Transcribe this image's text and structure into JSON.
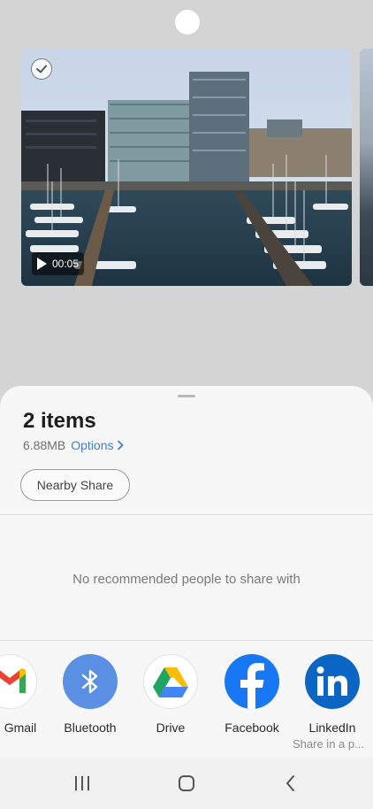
{
  "media": {
    "duration": "00:05",
    "selected": true
  },
  "share_sheet": {
    "title": "2 items",
    "size": "6.88MB",
    "options_label": "Options",
    "nearby_share_label": "Nearby Share",
    "no_people_text": "No recommended people to share with"
  },
  "apps": [
    {
      "label": "Gmail",
      "visible_label": "Gmail",
      "icon": "gmail-icon"
    },
    {
      "label": "Bluetooth",
      "icon": "bluetooth-icon"
    },
    {
      "label": "Drive",
      "icon": "drive-icon"
    },
    {
      "label": "Facebook",
      "icon": "facebook-icon"
    },
    {
      "label": "LinkedIn",
      "sublabel": "Share in a p...",
      "icon": "linkedin-icon"
    }
  ],
  "navbar": {
    "recent": "recent-apps-icon",
    "home": "home-icon",
    "back": "back-icon"
  },
  "colors": {
    "accent": "#3d7fd9",
    "bluetooth": "#5b8fe3",
    "facebook": "#1877f2",
    "linkedin": "#0a66c2"
  }
}
